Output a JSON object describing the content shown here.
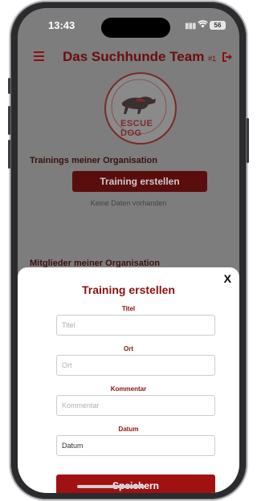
{
  "status_bar": {
    "time": "13:43",
    "battery": "56"
  },
  "header": {
    "title": "Das Suchhunde Team",
    "team_number": "#1"
  },
  "logo": {
    "text": "ESCUE DOG"
  },
  "trainings_section": {
    "title": "Trainings meiner Organisation",
    "create_button": "Training erstellen",
    "empty_text": "Keine Daten vorhanden"
  },
  "members_section": {
    "title": "Mitglieder meiner Organisation"
  },
  "modal": {
    "close_label": "X",
    "title": "Training erstellen",
    "fields": [
      {
        "label": "Titel",
        "placeholder": "Titel",
        "value": ""
      },
      {
        "label": "Ort",
        "placeholder": "Ort",
        "value": ""
      },
      {
        "label": "Kommentar",
        "placeholder": "Kommentar",
        "value": ""
      },
      {
        "label": "Datum",
        "placeholder": "",
        "value": "Datum"
      }
    ],
    "save_button": "Speichern"
  },
  "colors": {
    "accent": "#a11111",
    "dark_accent": "#6b0d0d"
  }
}
